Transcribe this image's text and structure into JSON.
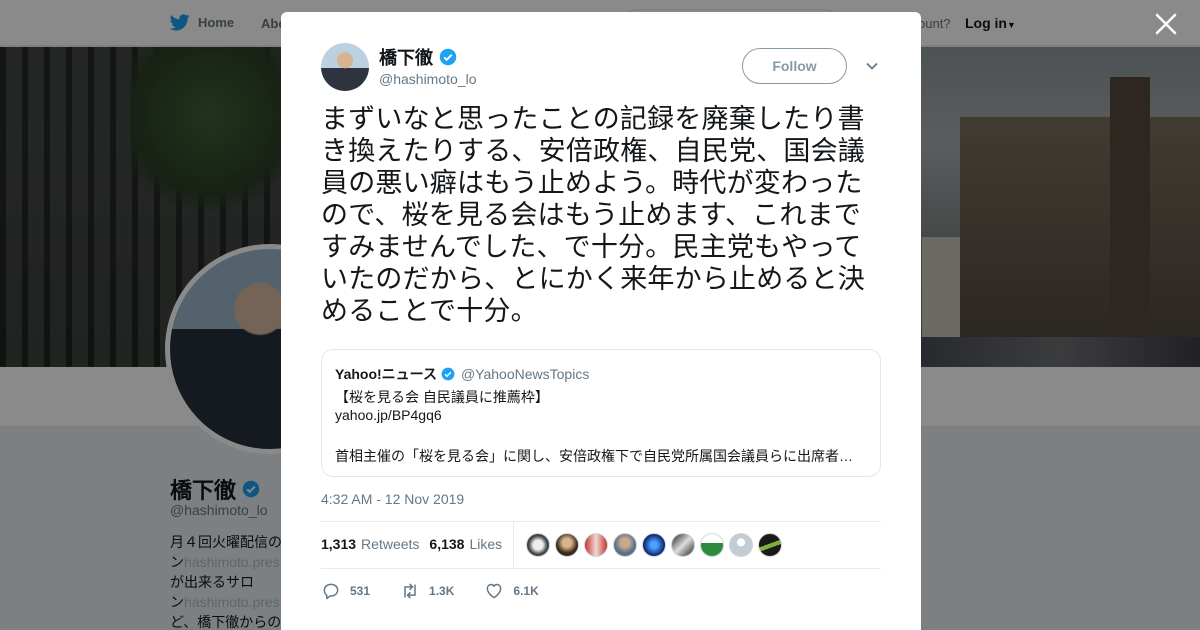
{
  "nav": {
    "home_label": "Home",
    "about_label": "Abo",
    "account_text": "ccount?",
    "login_label": "Log in"
  },
  "profile": {
    "name": "橋下徹",
    "handle": "@hashimoto_lo",
    "bio_lines": [
      "月４回火曜配信の",
      "ン",
      "hashimoto.pres",
      "が出来るサロ",
      "ン",
      "hashimoto.pres",
      "ど、橋下徹からの"
    ]
  },
  "tweet": {
    "author_name": "橋下徹",
    "author_handle": "@hashimoto_lo",
    "follow_label": "Follow",
    "text": "まずいなと思ったことの記録を廃棄したり書き換えたりする、安倍政権、自民党、国会議員の悪い癖はもう止めよう。時代が変わったので、桜を見る会はもう止めます、これまですみませんでした、で十分。民主党もやっていたのだから、とにかく来年から止めると決めることで十分。",
    "timestamp": "4:32 AM - 12 Nov 2019",
    "retweets_count": "1,313",
    "retweets_label": "Retweets",
    "likes_count": "6,138",
    "likes_label": "Likes",
    "reply_count": "531",
    "retweet_short": "1.3K",
    "like_short": "6.1K"
  },
  "quote": {
    "name": "Yahoo!ニュース",
    "handle": "@YahooNewsTopics",
    "line1": "【桜を見る会 自民議員に推薦枠】",
    "line2": "yahoo.jp/BP4gq6",
    "line3": "首相主催の「桜を見る会」に関し、安倍政権下で自民党所属国会議員らに出席者…"
  },
  "colors": {
    "twitter_blue": "#1da1f2",
    "verified_blue": "#1da1f2",
    "secondary_text": "#657786"
  },
  "icons": [
    "twitter-bird-icon",
    "verified-badge-icon",
    "chevron-down-icon",
    "close-icon",
    "reply-icon",
    "retweet-icon",
    "heart-icon"
  ]
}
